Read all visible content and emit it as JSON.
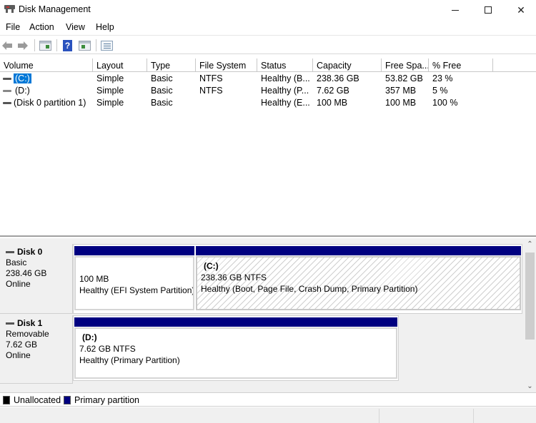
{
  "window": {
    "title": "Disk Management",
    "icons": {
      "app": "disk-management-icon",
      "minimize": "minimize-icon",
      "maximize": "maximize-icon",
      "close": "close-icon"
    },
    "close_glyph": "✕"
  },
  "menu": {
    "items": [
      {
        "label": "File"
      },
      {
        "label": "Action"
      },
      {
        "label": "View"
      },
      {
        "label": "Help"
      }
    ]
  },
  "toolbar": {
    "buttons": [
      "back-arrow-icon",
      "forward-arrow-icon",
      "show-hide-console-tree-icon",
      "help-icon",
      "show-hide-action-pane-icon",
      "properties-list-icon"
    ],
    "help_glyph": "?"
  },
  "volume_list": {
    "columns": [
      "Volume",
      "Layout",
      "Type",
      "File System",
      "Status",
      "Capacity",
      "Free Spa...",
      "% Free"
    ],
    "rows": [
      {
        "volume": "(C:)",
        "layout": "Simple",
        "type": "Basic",
        "file_system": "NTFS",
        "status": "Healthy (B...",
        "capacity": "238.36 GB",
        "free_space": "53.82 GB",
        "percent_free": "23 %",
        "selected": true
      },
      {
        "volume": "(D:)",
        "layout": "Simple",
        "type": "Basic",
        "file_system": "NTFS",
        "status": "Healthy (P...",
        "capacity": "7.62 GB",
        "free_space": "357 MB",
        "percent_free": "5 %",
        "selected": false
      },
      {
        "volume": "(Disk 0 partition 1)",
        "layout": "Simple",
        "type": "Basic",
        "file_system": "",
        "status": "Healthy (E...",
        "capacity": "100 MB",
        "free_space": "100 MB",
        "percent_free": "100 %",
        "selected": false
      }
    ]
  },
  "disks": [
    {
      "name": "Disk 0",
      "type": "Basic",
      "size": "238.46 GB",
      "state": "Online",
      "partitions": [
        {
          "title": "",
          "size_line": "100 MB",
          "status_line": "Healthy (EFI System Partition)",
          "hatched": false
        },
        {
          "title": "(C:)",
          "size_line": "238.36 GB NTFS",
          "status_line": "Healthy (Boot, Page File, Crash Dump, Primary Partition)",
          "hatched": true
        }
      ]
    },
    {
      "name": "Disk 1",
      "type": "Removable",
      "size": "7.62 GB",
      "state": "Online",
      "partitions": [
        {
          "title": "(D:)",
          "size_line": "7.62 GB NTFS",
          "status_line": "Healthy (Primary Partition)",
          "hatched": false
        }
      ]
    }
  ],
  "scrollbar": {
    "up_glyph": "⌃",
    "down_glyph": "⌄"
  },
  "legend": {
    "items": [
      {
        "label": "Unallocated",
        "color": "#000000"
      },
      {
        "label": "Primary partition",
        "color": "#000080"
      }
    ]
  },
  "colors": {
    "primary_partition": "#000080",
    "selection": "#0078d7"
  }
}
